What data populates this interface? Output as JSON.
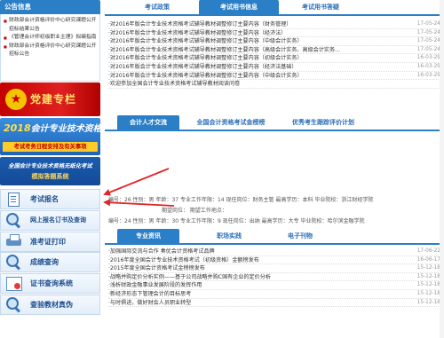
{
  "notice": {
    "title": "公告信息",
    "items": [
      {
        "bullet": "■",
        "text": "财政部会计资格评价中心研究课题公开招标结果公告"
      },
      {
        "bullet": "■",
        "text": "《管理会计师初级职业主理》拟编指南"
      },
      {
        "bullet": "■",
        "text": "财政部会计资格评价中心研究课题公开招标公告"
      }
    ]
  },
  "banners": {
    "party": {
      "emblem": "★",
      "text": "党建专栏"
    },
    "exam2018": {
      "year": "2018",
      "title": "会计专业技术资格",
      "subtitle": "考试考务日程安排及有关事项"
    },
    "mock": {
      "line1": "全国会计专业技术资格无纸化考试",
      "line2": "模拟答题系统"
    }
  },
  "side_nav": [
    {
      "icon": "document-icon",
      "label": "考试报名"
    },
    {
      "icon": "magnifier-icon",
      "label": "网上报名订书及查询"
    },
    {
      "icon": "printer-icon",
      "label": "准考证打印"
    },
    {
      "icon": "magnifier-icon",
      "label": "成绩查询"
    },
    {
      "icon": "certificate-icon",
      "label": "证书查询系统"
    },
    {
      "icon": "magnifier-icon",
      "label": "查验教材真伪"
    }
  ],
  "top_tabs": [
    "考试政策",
    "考试用书信息",
    "考试用书答疑"
  ],
  "top_news": [
    {
      "title": "·对2016年版会计专业技术资格考试辅导教材调整修订主要内容（财务管理）",
      "date": "17-05-24"
    },
    {
      "title": "·对2016年版会计专业技术资格考试辅导教材调整修订主要内容（经济法）",
      "date": "17-05-24"
    },
    {
      "title": "·对2016年版会计专业技术资格考试辅导教材调整修订主要内容（中级会计实务）",
      "date": "17-05-24"
    },
    {
      "title": "·对2016年版会计专业技术资格考试辅导教材调整修订主要内容（高级会计实务、高级会计实务...",
      "date": "17-05-24"
    },
    {
      "title": "·对2016年版会计专业技术资格考试辅导教材调整修订主要内容（初级会计实务）",
      "date": "16-03-29"
    },
    {
      "title": "·对2016年版会计专业技术资格考试辅导教材调整修订主要内容（经济法基础）",
      "date": "16-03-29"
    },
    {
      "title": "·对2016年版会计专业技术资格考试辅导教材调整修订主要内容（中级会计实务）",
      "date": "16-03-29"
    },
    {
      "title": "·欢迎参加全国会计专业技术资格考试辅导教材阅读问卷",
      "date": ""
    }
  ],
  "mid_tabs": [
    "会计人才交流",
    "全国会计资格考试金榜榜",
    "优秀考生跟踪评价计划"
  ],
  "talent": [
    {
      "text": "编号：26  性别：男  年龄：37  专业工作年限：14  现任岗位：财务主管  最高学历：本科  毕业院校：浙江财经学院"
    },
    {
      "text": "编号：24  性别：男  年龄：30  专业工作年限：9  现任岗位：出纳  最高学历：大专  毕业院校：哈尔滨金融学院"
    }
  ],
  "talent_extra": "期望岗位：  期望工作地点：",
  "bottom_tabs": [
    "专业资讯",
    "职场实践",
    "电子刊物"
  ],
  "bottom_news": [
    {
      "title": "·加强国际交流与合作   奏优会计资格考试品牌",
      "date": "17-06-22"
    },
    {
      "title": "·2016年度全国会计专业技术资格考试（初级资格）金额榜发布",
      "date": "16-06-17"
    },
    {
      "title": "·2015年度全国会计资格考试金榜榜发布",
      "date": "15-12-18"
    },
    {
      "title": "·战略并购定价分析实例——基于公司战略并购C国有企业的定价分析",
      "date": "15-12-18"
    },
    {
      "title": "·浅析财政金融事业发展阶段的发挥作用",
      "date": "15-12-18"
    },
    {
      "title": "·新经济形态下管理会计的目标思考",
      "date": "15-12-18"
    },
    {
      "title": "·与时俱进，做好财会人员职业转型",
      "date": "15-12-18"
    }
  ]
}
